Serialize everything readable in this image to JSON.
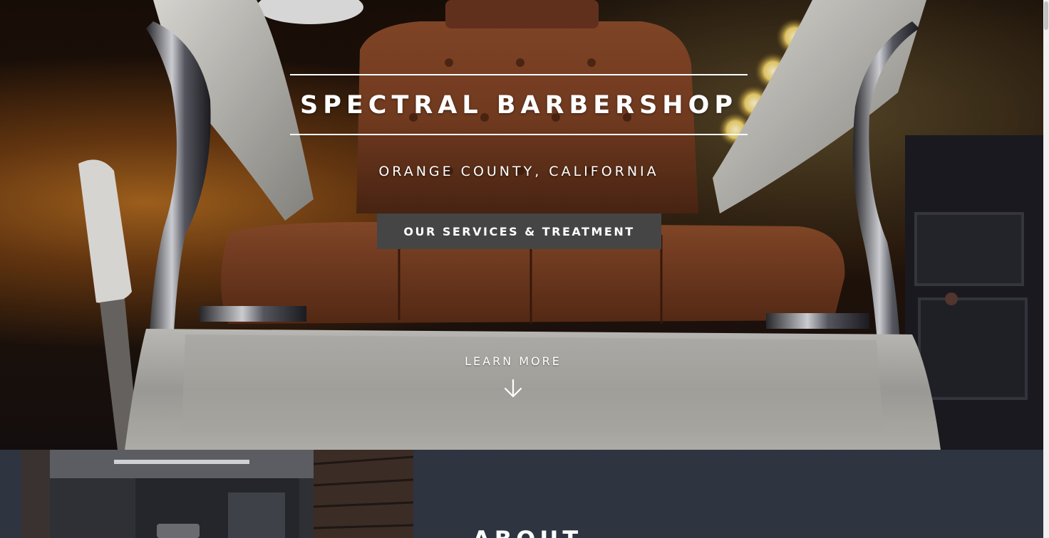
{
  "hero": {
    "title": "SPECTRAL BARBERSHOP",
    "subtitle": "ORANGE COUNTY, CALIFORNIA",
    "cta_label": "OUR SERVICES & TREATMENT",
    "learn_more_label": "LEARN MORE",
    "learn_more_icon": "arrow-down-icon",
    "background_image": "barber-chair-photo"
  },
  "about": {
    "heading": "ABOUT",
    "image": "barbershop-interior-photo"
  },
  "colors": {
    "about_background": "#2e3440",
    "button_background": "#454546",
    "text": "#ffffff"
  }
}
